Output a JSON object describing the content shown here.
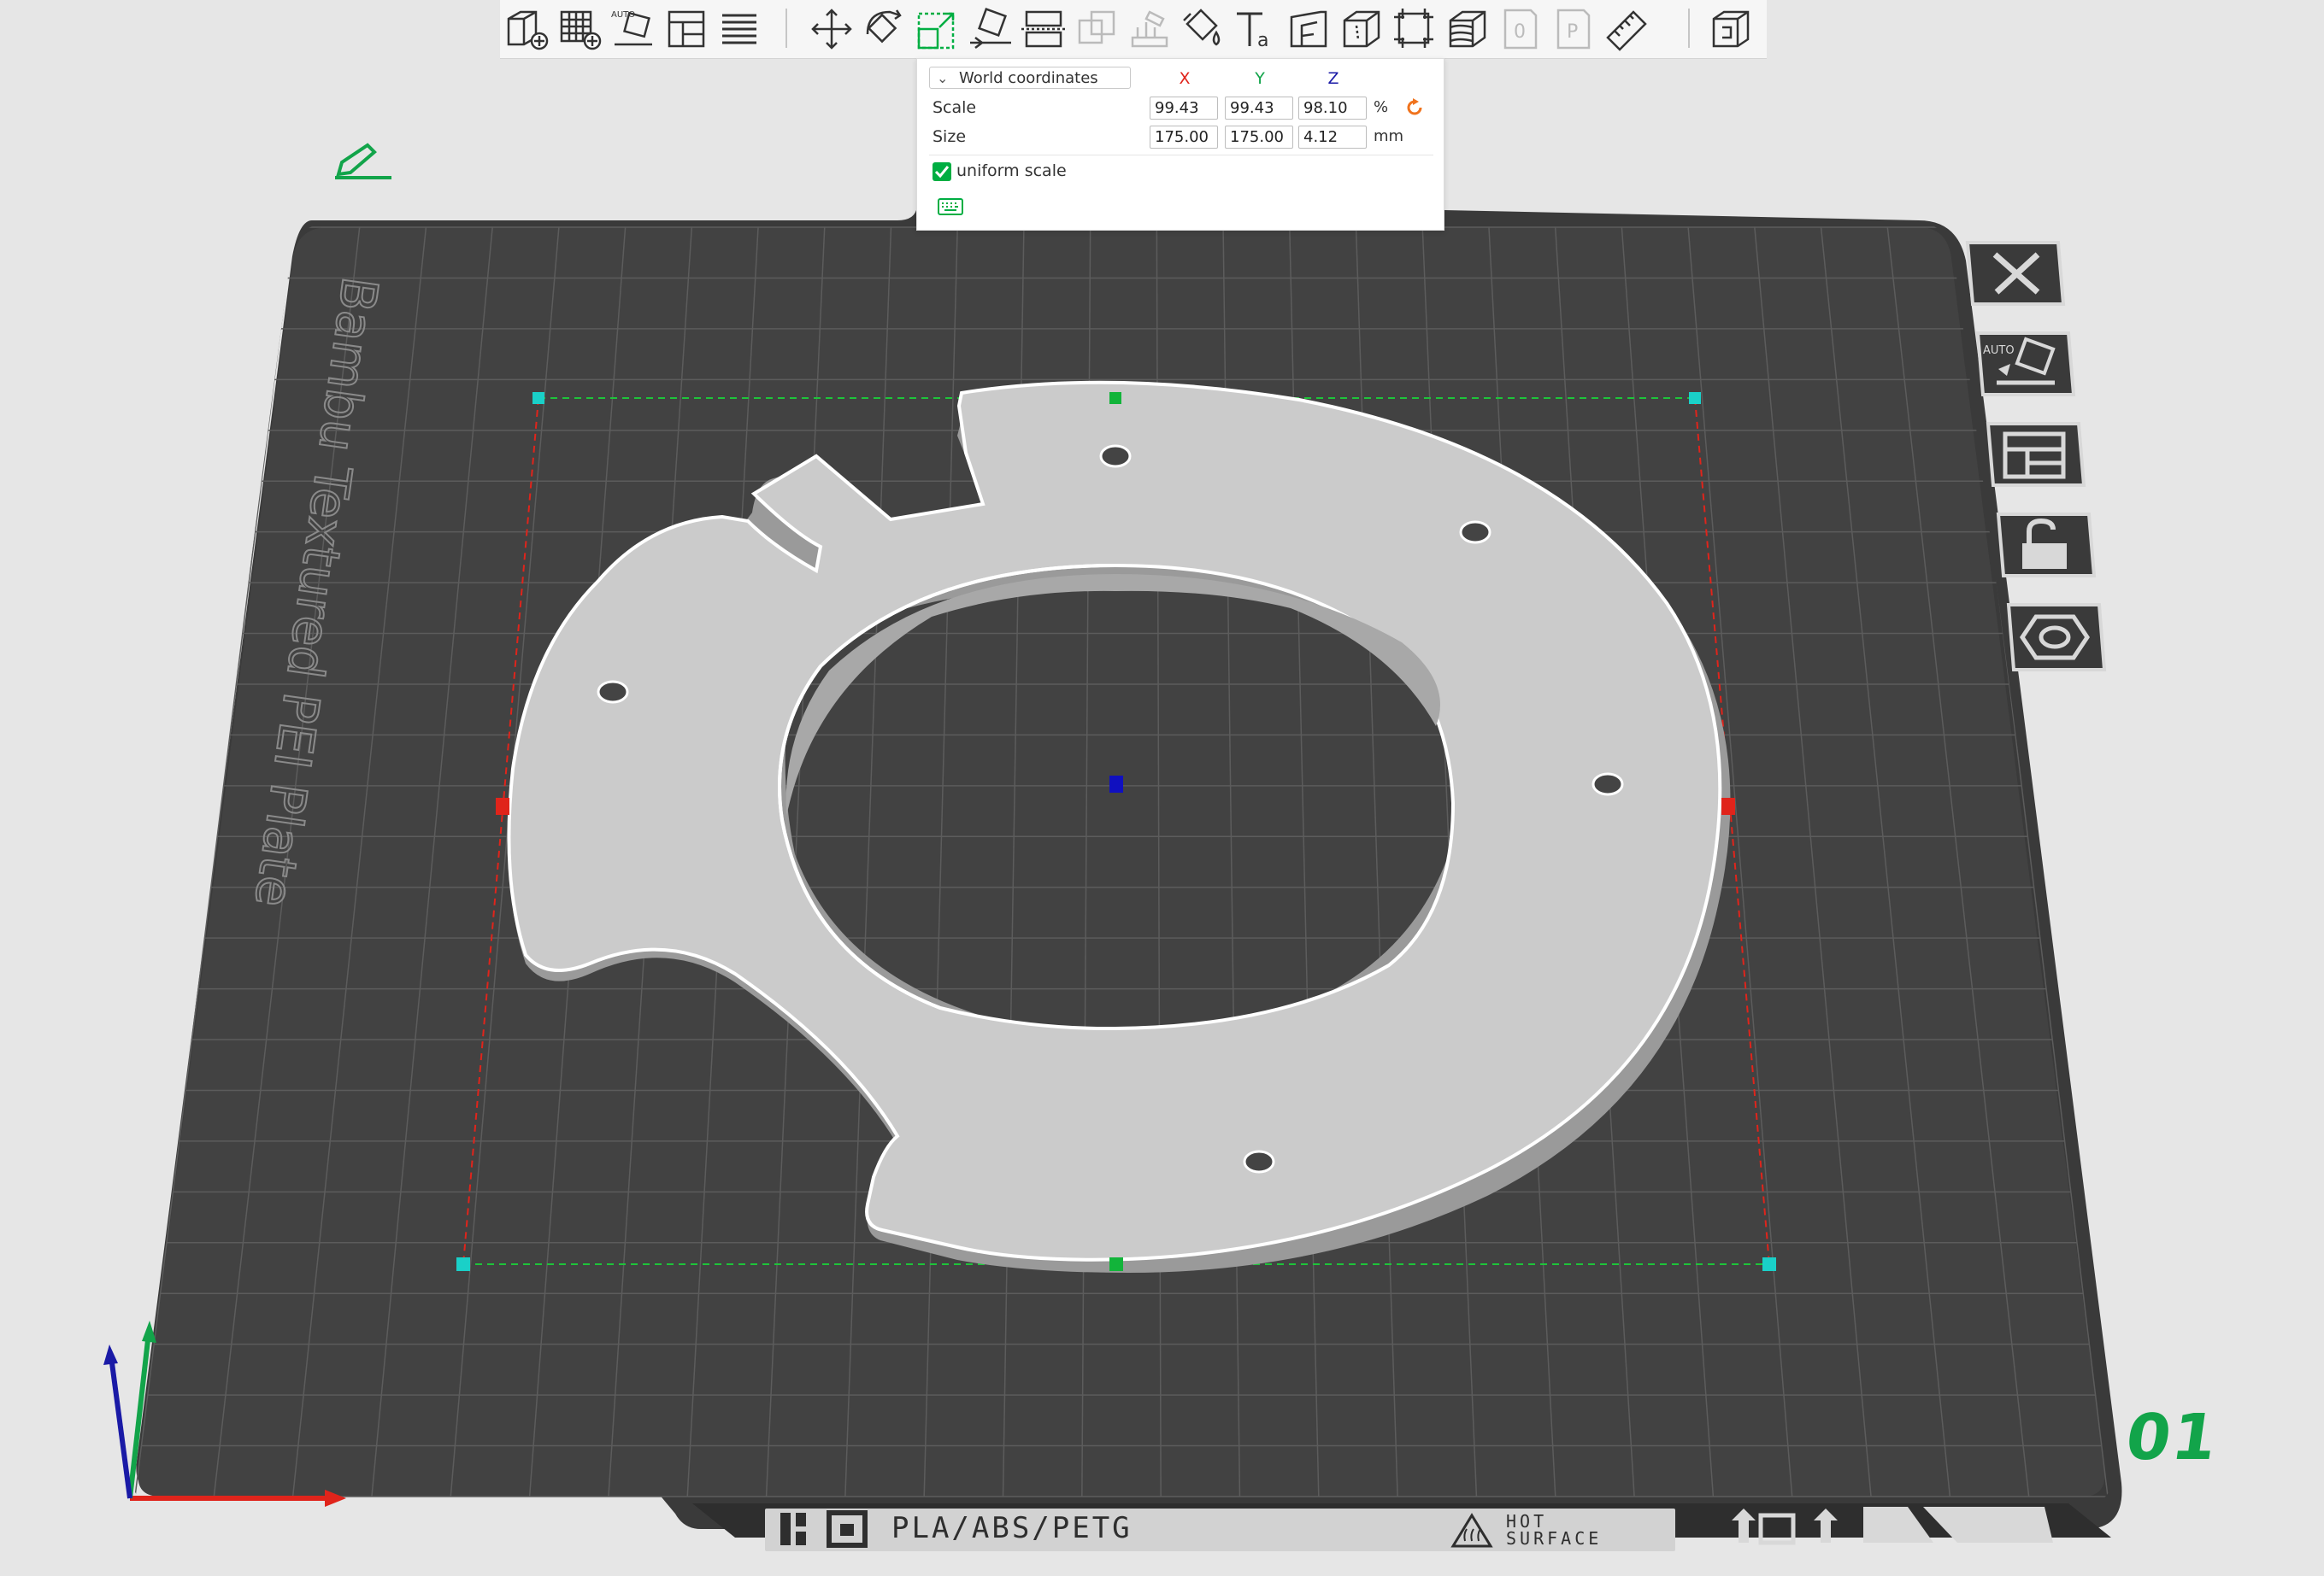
{
  "toolbar": {
    "tools": [
      {
        "name": "add-object-icon"
      },
      {
        "name": "add-plate-icon"
      },
      {
        "name": "auto-orient-icon",
        "label": "AUTO"
      },
      {
        "name": "arrange-icon"
      },
      {
        "name": "split-layers-icon"
      },
      {
        "name": "move-icon"
      },
      {
        "name": "rotate-icon"
      },
      {
        "name": "scale-icon",
        "active": true
      },
      {
        "name": "lay-on-face-icon"
      },
      {
        "name": "cut-icon"
      },
      {
        "name": "mesh-boolean-icon"
      },
      {
        "name": "support-paint-icon"
      },
      {
        "name": "color-paint-icon"
      },
      {
        "name": "text-icon"
      },
      {
        "name": "emboss-icon"
      },
      {
        "name": "hollow-icon"
      },
      {
        "name": "simplify-icon"
      },
      {
        "name": "variable-layer-icon"
      },
      {
        "name": "brim-ears-icon",
        "label": "0"
      },
      {
        "name": "seam-paint-icon",
        "label": "P"
      },
      {
        "name": "measure-icon"
      },
      {
        "name": "assembly-view-icon"
      }
    ]
  },
  "scale_panel": {
    "coordinate_system": "World coordinates",
    "axes": {
      "x": "X",
      "y": "Y",
      "z": "Z"
    },
    "scale": {
      "label": "Scale",
      "x": "99.43",
      "y": "99.43",
      "z": "98.10",
      "unit": "%"
    },
    "size": {
      "label": "Size",
      "x": "175.00",
      "y": "175.00",
      "z": "4.12",
      "unit": "mm"
    },
    "uniform_scale": {
      "label": "uniform scale",
      "checked": true
    }
  },
  "bed": {
    "plate_name": "Bambu Textured PEI Plate",
    "plate_number": "01",
    "filament_text": "PLA/ABS/PETG",
    "hot_surface_text": [
      "HOT",
      "SURFACE"
    ]
  },
  "colors": {
    "accent": "#00ae42",
    "bed": "#3f3f3f",
    "grid": "#5a5a5a",
    "object": "#c8c8c8",
    "axis_x": "#e0241b",
    "axis_y": "#12a44a",
    "axis_z": "#1a1aa6",
    "reset_icon": "#f0731d"
  },
  "side_toolbar": {
    "buttons": [
      {
        "name": "close-plate-icon"
      },
      {
        "name": "auto-orient-plate-icon",
        "label": "AUTO"
      },
      {
        "name": "arrange-plate-icon"
      },
      {
        "name": "lock-plate-icon"
      },
      {
        "name": "plate-settings-icon"
      }
    ]
  }
}
